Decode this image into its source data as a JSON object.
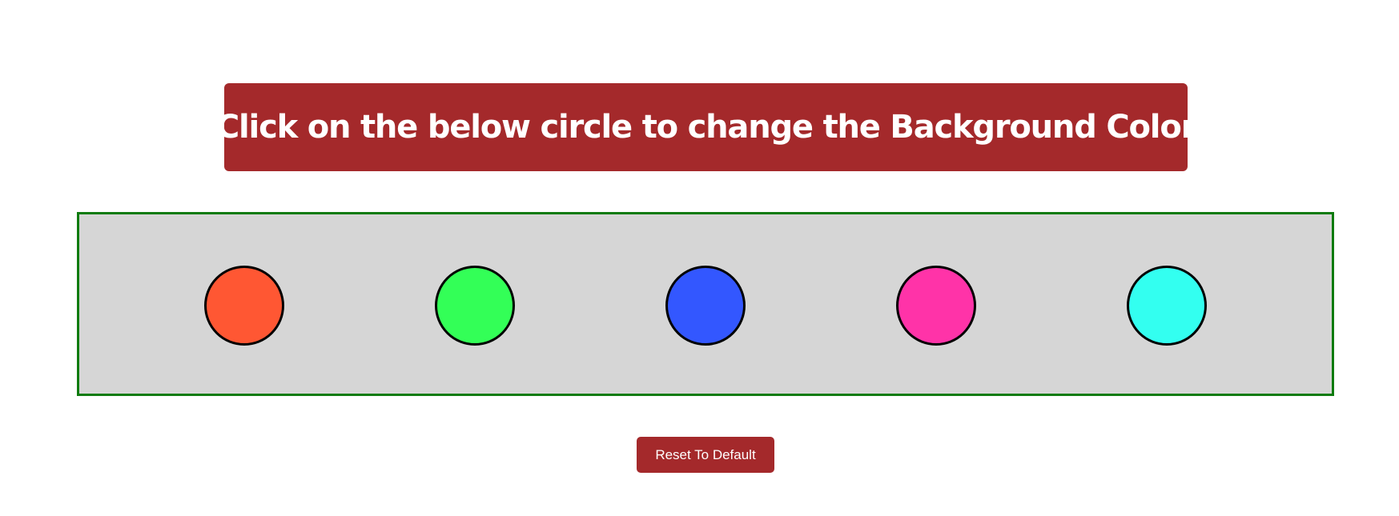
{
  "header": {
    "title": "Click on the below circle to change the Background Color",
    "banner_color": "#a4292b"
  },
  "panel": {
    "background": "#d6d6d6",
    "border_color": "#0f7b0f",
    "circles": [
      {
        "name": "orange",
        "color": "#ff5733"
      },
      {
        "name": "green",
        "color": "#33ff57"
      },
      {
        "name": "blue",
        "color": "#3357ff"
      },
      {
        "name": "pink",
        "color": "#ff33a8"
      },
      {
        "name": "cyan",
        "color": "#33fff0"
      }
    ]
  },
  "reset": {
    "label": "Reset To Default",
    "color": "#a4292b"
  }
}
